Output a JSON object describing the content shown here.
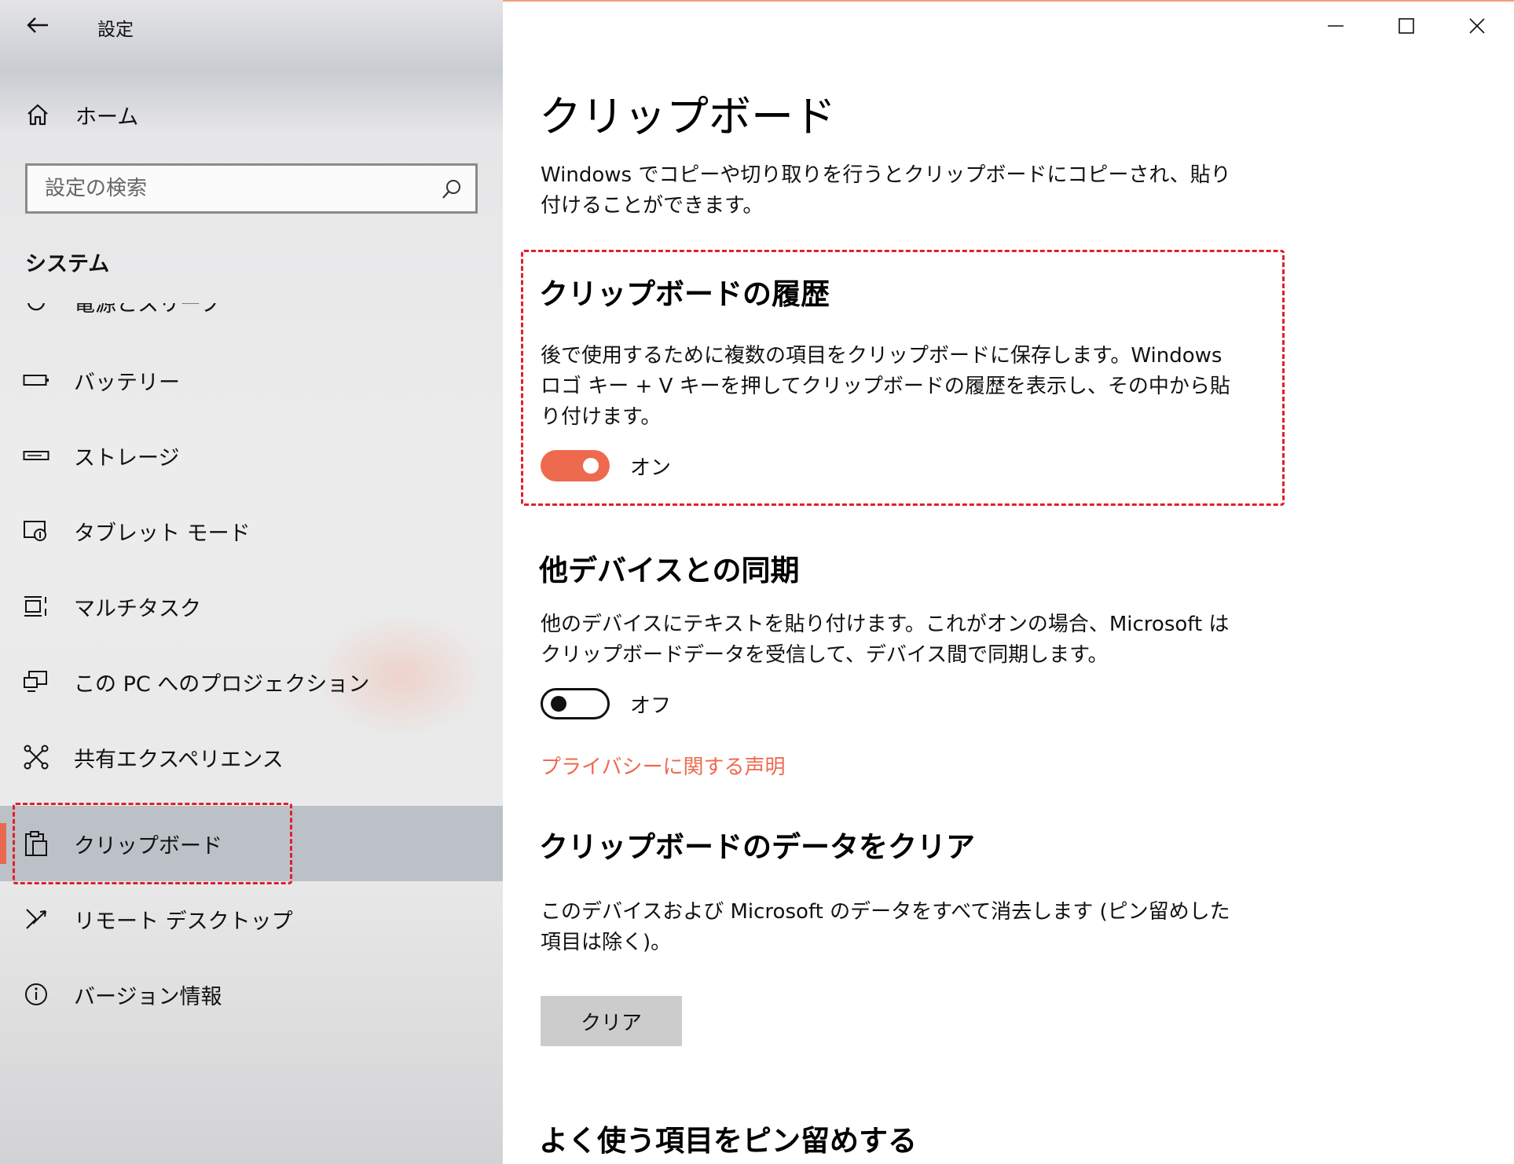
{
  "window": {
    "title": "設定",
    "controls": [
      "minimize",
      "maximize",
      "close"
    ]
  },
  "sidebar": {
    "home_label": "ホーム",
    "search_placeholder": "設定の検索",
    "section_title": "システム",
    "items": [
      {
        "label": "電源とスリープ",
        "icon": "power-icon"
      },
      {
        "label": "バッテリー",
        "icon": "battery-icon"
      },
      {
        "label": "ストレージ",
        "icon": "storage-icon"
      },
      {
        "label": "タブレット モード",
        "icon": "tablet-mode-icon"
      },
      {
        "label": "マルチタスク",
        "icon": "multitasking-icon"
      },
      {
        "label": "この PC へのプロジェクション",
        "icon": "projection-icon"
      },
      {
        "label": "共有エクスペリエンス",
        "icon": "shared-experiences-icon"
      },
      {
        "label": "クリップボード",
        "icon": "clipboard-icon",
        "selected": true
      },
      {
        "label": "リモート デスクトップ",
        "icon": "remote-desktop-icon"
      },
      {
        "label": "バージョン情報",
        "icon": "info-icon"
      }
    ]
  },
  "main": {
    "title": "クリップボード",
    "intro": "Windows でコピーや切り取りを行うとクリップボードにコピーされ、貼り付けることができます。",
    "history": {
      "heading": "クリップボードの履歴",
      "description": "後で使用するために複数の項目をクリップボードに保存します。Windows ロゴ キー + V キーを押してクリップボードの履歴を表示し、その中から貼り付けます。",
      "toggle_state": "on",
      "toggle_label": "オン"
    },
    "sync": {
      "heading": "他デバイスとの同期",
      "description": "他のデバイスにテキストを貼り付けます。これがオンの場合、Microsoft はクリップボードデータを受信して、デバイス間で同期します。",
      "toggle_state": "off",
      "toggle_label": "オフ"
    },
    "privacy_link": "プライバシーに関する声明",
    "clear": {
      "heading": "クリップボードのデータをクリア",
      "description": "このデバイスおよび Microsoft のデータをすべて消去します (ピン留めした項目は除く)。",
      "button_label": "クリア"
    },
    "pin_heading": "よく使う項目をピン留めする"
  },
  "colors": {
    "accent": "#ee6a4f",
    "highlight_box": "#e0202a",
    "selected_bg": "#bcc1c8"
  }
}
